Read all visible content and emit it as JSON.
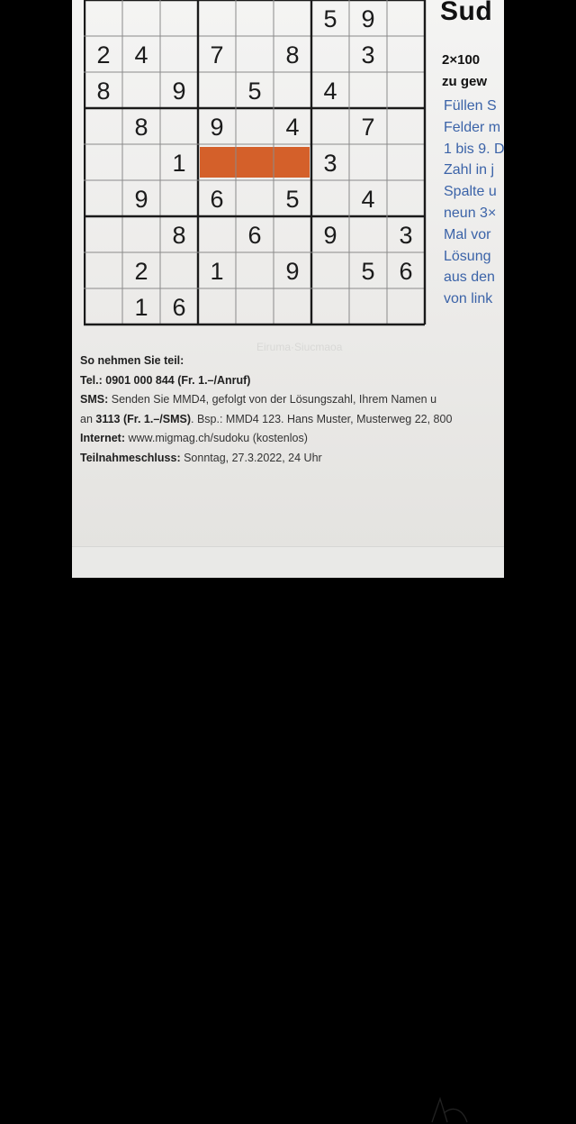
{
  "puzzle": {
    "rows": [
      [
        "",
        "",
        "",
        "",
        "",
        "",
        "5",
        "9",
        ""
      ],
      [
        "2",
        "4",
        "",
        "7",
        "",
        "8",
        "",
        "3",
        ""
      ],
      [
        "8",
        "",
        "9",
        "",
        "5",
        "",
        "4",
        "",
        ""
      ],
      [
        "",
        "8",
        "",
        "9",
        "",
        "4",
        "",
        "7",
        ""
      ],
      [
        "",
        "",
        "1",
        "",
        "",
        "",
        "3",
        "",
        ""
      ],
      [
        "",
        "9",
        "",
        "6",
        "",
        "5",
        "",
        "4",
        ""
      ],
      [
        "",
        "",
        "8",
        "",
        "6",
        "",
        "9",
        "",
        "3"
      ],
      [
        "",
        "2",
        "",
        "1",
        "",
        "9",
        "",
        "5",
        "6"
      ],
      [
        "",
        "1",
        "6",
        "",
        "",
        "",
        "",
        "",
        ""
      ]
    ],
    "highlight_row": 4,
    "highlight_cols": [
      3,
      4,
      5
    ],
    "highlight_color": "#d4602a"
  },
  "side": {
    "title": "Sud",
    "subtitle_lines": [
      "2×100",
      "zu gew"
    ],
    "body_lines": [
      "Füllen S",
      "Felder m",
      "1 bis 9. D",
      "Zahl in j",
      "Spalte u",
      "neun 3×",
      "Mal vor",
      "Lösung",
      "aus den",
      "von link"
    ],
    "body_color": "#3b63a8"
  },
  "info": {
    "heading": "So nehmen Sie teil:",
    "tel_label": "Tel.:",
    "tel_value": "0901 000 844 (Fr. 1.–/Anruf)",
    "sms_label": "SMS:",
    "sms_text": "Senden Sie MMD4, gefolgt von der Lösungszahl, Ihrem Namen u",
    "sms_line2_pre": "an",
    "sms_line2_bold": "3113 (Fr. 1.–/SMS)",
    "sms_line2_rest": ". Bsp.: MMD4 123. Hans Muster, Musterweg 22, 800",
    "internet_label": "Internet:",
    "internet_value": "www.migmag.ch/sudoku (kostenlos)",
    "deadline_label": "Teilnahmeschluss:",
    "deadline_value": "Sonntag, 27.3.2022, 24 Uhr"
  }
}
